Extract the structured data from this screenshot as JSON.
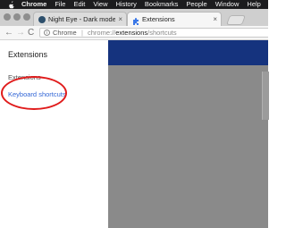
{
  "menubar": {
    "app": "Chrome",
    "items": [
      "File",
      "Edit",
      "View",
      "History",
      "Bookmarks",
      "People",
      "Window",
      "Help"
    ]
  },
  "tabs": [
    {
      "title": "Night Eye - Dark mode extensi",
      "close": "×"
    },
    {
      "title": "Extensions",
      "close": "×"
    }
  ],
  "toolbar": {
    "back": "←",
    "forward": "→",
    "reload": "C"
  },
  "omnibox": {
    "scheme_label": "Chrome",
    "separator": "|",
    "url_prefix": "chrome://",
    "url_host": "extensions",
    "url_path": "/shortcuts"
  },
  "sidebar": {
    "title": "Extensions",
    "items": [
      "Extensions",
      "Keyboard shortcuts"
    ]
  },
  "colors": {
    "header": "#15337e",
    "content": "#8a8a8a",
    "link": "#3367d6",
    "highlight": "#e01b1b"
  }
}
